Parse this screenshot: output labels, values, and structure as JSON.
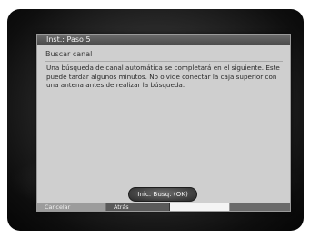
{
  "dialog": {
    "title": "Inst.: Paso 5",
    "subtitle": "Buscar canal",
    "message": "Una búsqueda de canal automática se completará en el siguiente. Este puede tardar algunos minutos. No olvide conectar la caja superior con una antena antes de realizar la búsqueda.",
    "start_button_label": "Inic. Busq. (OK)"
  },
  "footer": {
    "red_label": "Cancelar",
    "green_label": "Atrás",
    "yellow_label": "",
    "blue_label": ""
  }
}
